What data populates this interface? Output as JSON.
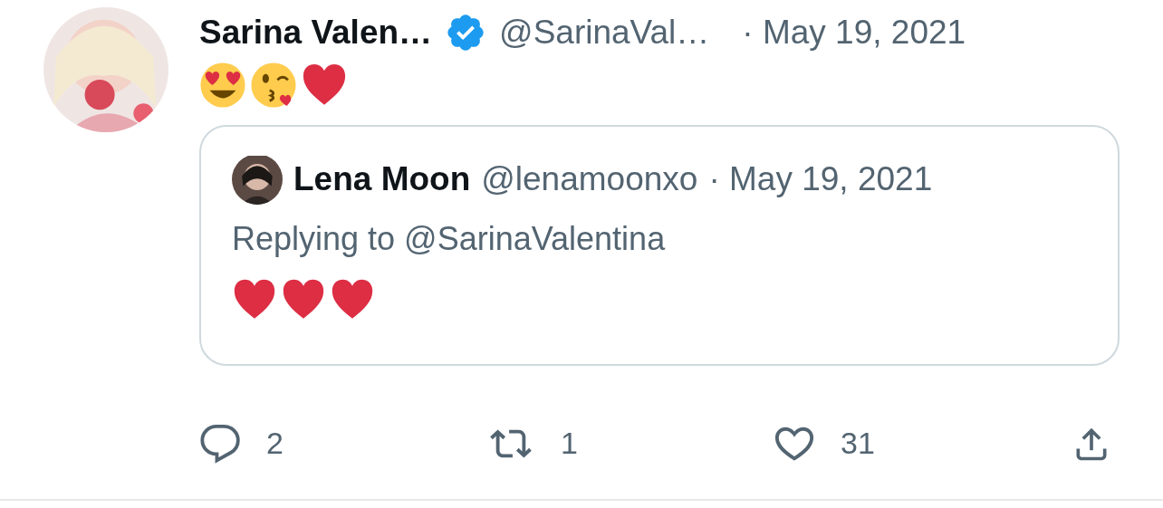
{
  "tweet": {
    "author": {
      "name": "Sarina Valen…",
      "verified": true,
      "handle": "@SarinaVal…",
      "date": "· May 19, 2021"
    },
    "emojis": [
      {
        "kind": "heart_eyes"
      },
      {
        "kind": "kiss_wink"
      },
      {
        "kind": "heart"
      }
    ],
    "quote": {
      "name": "Lena Moon",
      "handle": "@lenamoonxo",
      "date": "· May 19, 2021",
      "replying": "Replying to @SarinaValentina",
      "emojis": [
        {
          "kind": "heart"
        },
        {
          "kind": "heart"
        },
        {
          "kind": "heart"
        }
      ]
    },
    "actions": [
      {
        "kind": "reply",
        "count": "2"
      },
      {
        "kind": "retweet",
        "count": "1"
      },
      {
        "kind": "like",
        "count": "31"
      },
      {
        "kind": "share"
      }
    ]
  }
}
